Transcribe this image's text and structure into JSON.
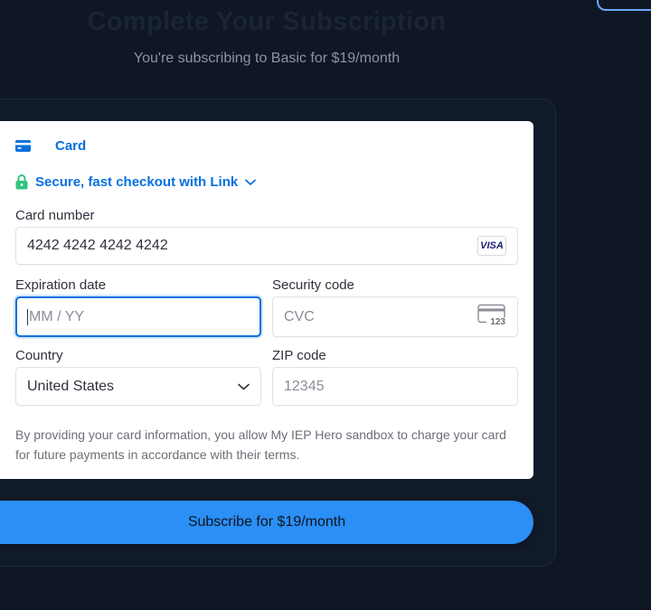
{
  "header": {
    "title": "Complete Your Subscription",
    "subtitle": "You're subscribing to Basic for $19/month"
  },
  "payment": {
    "tab_label": "Card",
    "link_text": "Secure, fast checkout with Link",
    "card_number": {
      "label": "Card number",
      "value": "4242 4242 4242 4242",
      "brand": "VISA"
    },
    "expiration": {
      "label": "Expiration date",
      "placeholder": "MM / YY"
    },
    "security": {
      "label": "Security code",
      "placeholder": "CVC",
      "icon_text": "123"
    },
    "country": {
      "label": "Country",
      "value": "United States"
    },
    "zip": {
      "label": "ZIP code",
      "placeholder": "12345"
    },
    "legal": "By providing your card information, you allow My IEP Hero sandbox to charge your card for future payments in accordance with their terms."
  },
  "subscribe_button": {
    "label": "Subscribe for $19/month"
  },
  "colors": {
    "accent": "#0570de",
    "button": "#2b8ff5",
    "link_lock": "#33c27f",
    "background": "#0f1724"
  }
}
